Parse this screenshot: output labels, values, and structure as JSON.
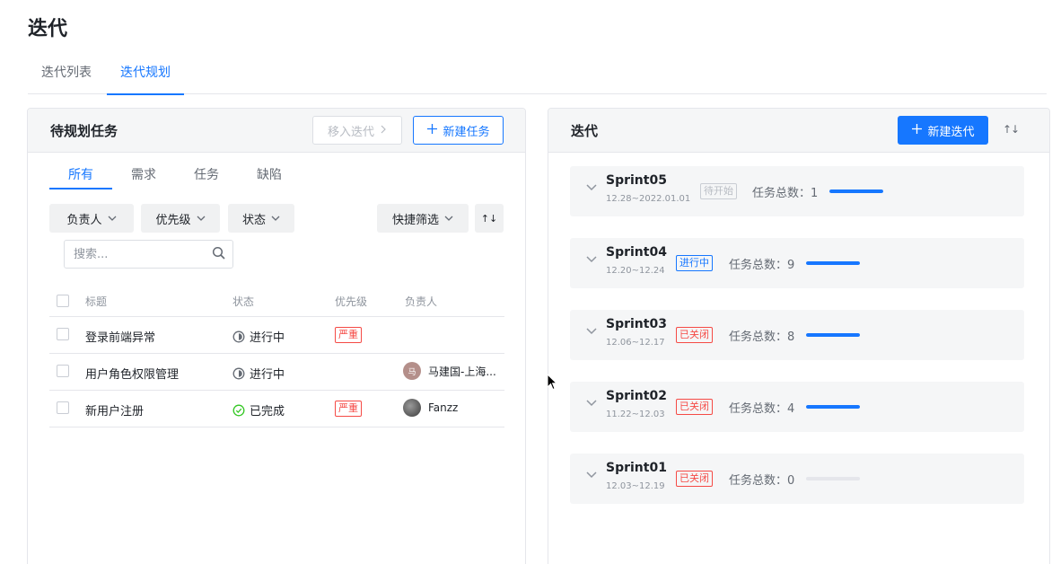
{
  "page": {
    "title": "迭代"
  },
  "tabs": [
    {
      "label": "迭代列表",
      "active": false
    },
    {
      "label": "迭代规划",
      "active": true
    }
  ],
  "left_panel": {
    "title": "待规划任务",
    "move_button": "移入迭代",
    "new_task_button": "新建任务",
    "subtabs": [
      "所有",
      "需求",
      "任务",
      "缺陷"
    ],
    "active_subtab": "所有",
    "filters": [
      "负责人",
      "优先级",
      "状态"
    ],
    "quick_filter": "快捷筛选",
    "sort_label": "↑↓",
    "search": {
      "placeholder": "搜索...",
      "value": ""
    },
    "columns": [
      "标题",
      "状态",
      "优先级",
      "负责人"
    ],
    "rows": [
      {
        "title": "登录前端异常",
        "status": "进行中",
        "status_icon": "half-circle-icon",
        "priority": "严重",
        "assignee": "",
        "avatar_text": ""
      },
      {
        "title": "用户角色权限管理",
        "status": "进行中",
        "status_icon": "half-circle-icon",
        "priority": "",
        "assignee": "马建国-上海...",
        "avatar_text": "马"
      },
      {
        "title": "新用户注册",
        "status": "已完成",
        "status_icon": "check-circle-icon",
        "priority": "严重",
        "assignee": "Fanzz",
        "avatar_text": ""
      }
    ]
  },
  "right_panel": {
    "title": "迭代",
    "new_sprint_button": "新建迭代",
    "sort_label": "↑↓",
    "count_label": "任务总数：",
    "sprints": [
      {
        "name": "Sprint05",
        "dates": "12.28~2022.01.01",
        "status": "待开始",
        "status_type": "pending",
        "count": "1",
        "progress": 1.0
      },
      {
        "name": "Sprint04",
        "dates": "12.20~12.24",
        "status": "进行中",
        "status_type": "active",
        "count": "9",
        "progress": 1.0
      },
      {
        "name": "Sprint03",
        "dates": "12.06~12.17",
        "status": "已关闭",
        "status_type": "closed",
        "count": "8",
        "progress": 1.0
      },
      {
        "name": "Sprint02",
        "dates": "11.22~12.03",
        "status": "已关闭",
        "status_type": "closed",
        "count": "4",
        "progress": 1.0
      },
      {
        "name": "Sprint01",
        "dates": "12.03~12.19",
        "status": "已关闭",
        "status_type": "closed",
        "count": "0",
        "progress": 0.0
      }
    ]
  },
  "colors": {
    "primary": "#1677ff",
    "danger": "#f54a45",
    "success": "#34c724",
    "muted": "#8f959e"
  }
}
